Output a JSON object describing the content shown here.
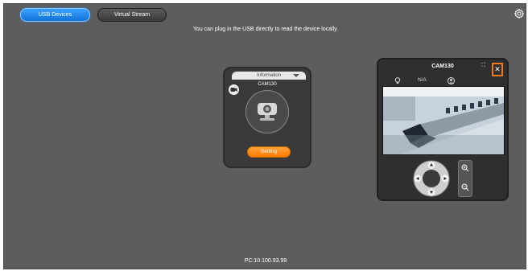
{
  "tabs": [
    {
      "label": "USB Devices",
      "active": true
    },
    {
      "label": "Virtual Stream",
      "active": false
    }
  ],
  "hint": "You can plug in the USB directly to read the device locally.",
  "settings_icon": "gear-icon",
  "info_card": {
    "header": "Information",
    "camera_name": "CAM130",
    "button": "Setting"
  },
  "preview": {
    "title": "CAM130",
    "status": "N/A",
    "expand_glyph": "⛶",
    "close_glyph": "✕"
  },
  "footer": {
    "ip": "PC:10.100.93.99"
  },
  "colors": {
    "accent_blue": "#1e86f0",
    "accent_orange": "#ff8a00",
    "panel_bg": "#5d5d5d"
  }
}
